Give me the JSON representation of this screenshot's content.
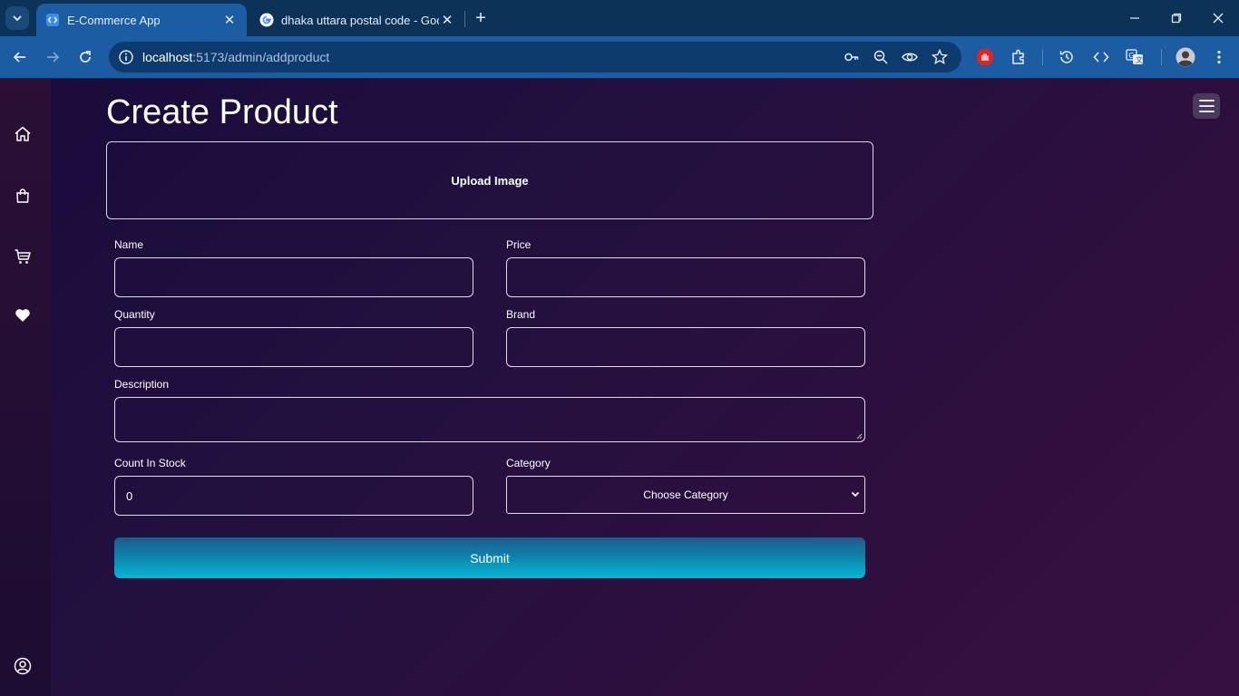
{
  "browser": {
    "tabs": [
      {
        "title": "E-Commerce App",
        "active": true,
        "icon": "code-icon"
      },
      {
        "title": "dhaka uttara postal code - Goo",
        "active": false,
        "icon": "google-icon"
      }
    ],
    "url_host": "localhost",
    "url_path": ":5173/admin/addproduct"
  },
  "sidebar": {
    "items": [
      "home-icon",
      "shopping-bag-icon",
      "cart-icon",
      "heart-icon"
    ],
    "bottom_item": "user-circle-icon"
  },
  "form": {
    "title": "Create Product",
    "upload_label": "Upload Image",
    "fields": {
      "name": {
        "label": "Name",
        "value": ""
      },
      "price": {
        "label": "Price",
        "value": ""
      },
      "quantity": {
        "label": "Quantity",
        "value": ""
      },
      "brand": {
        "label": "Brand",
        "value": ""
      },
      "description": {
        "label": "Description",
        "value": ""
      },
      "count_in_stock": {
        "label": "Count In Stock",
        "value": "0"
      },
      "category": {
        "label": "Category",
        "selected": "Choose Category"
      }
    },
    "submit_label": "Submit"
  },
  "colors": {
    "accent": "#06b6d4",
    "toolbar": "#1c5ca3",
    "page_bg_start": "#1a0b3c",
    "page_bg_end": "#361040"
  }
}
